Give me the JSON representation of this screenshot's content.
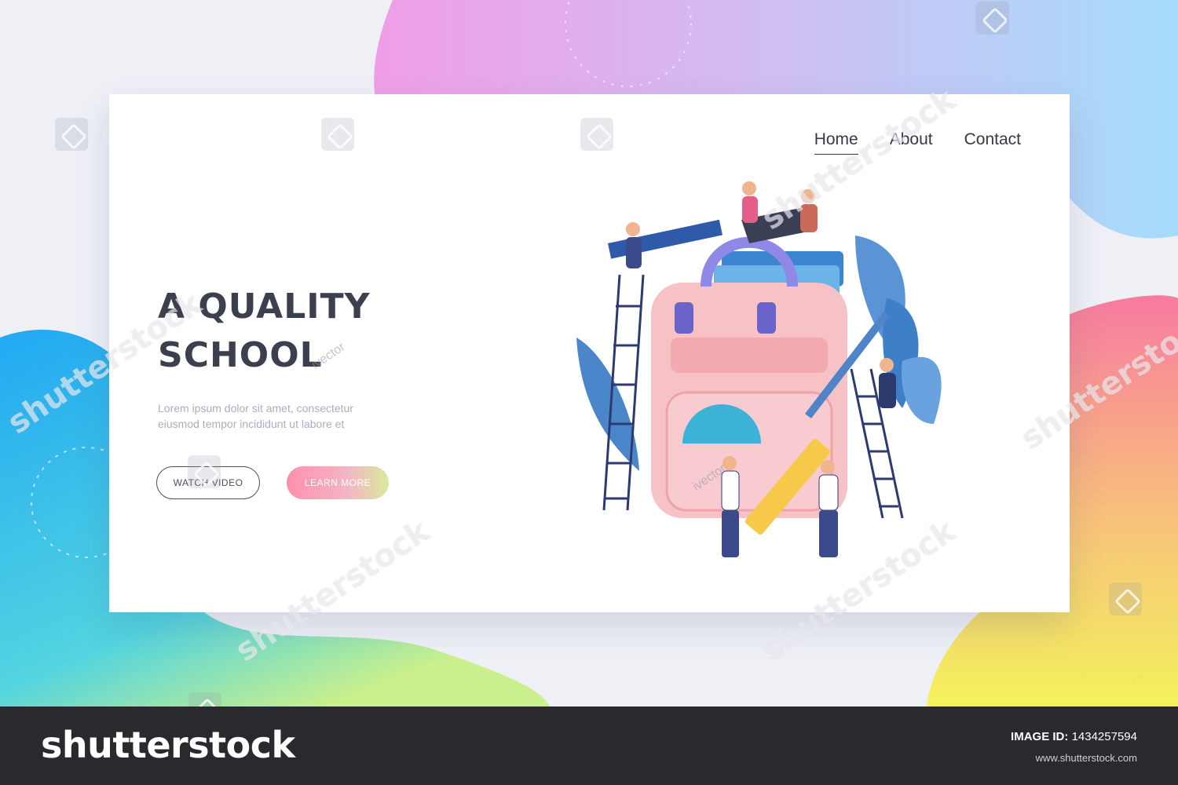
{
  "nav": {
    "items": [
      {
        "label": "Home",
        "active": true
      },
      {
        "label": "About",
        "active": false
      },
      {
        "label": "Contact",
        "active": false
      }
    ]
  },
  "hero": {
    "headline": "A QUALITY SCHOOL",
    "lead": "Lorem ipsum dolor sit amet, consectetur eiusmod tempor incididunt ut labore et",
    "watch_button": "WATCH VIDEO",
    "learn_button": "LEARN MORE"
  },
  "watermark": {
    "text": "shutterstock",
    "vector_tag": "ivector"
  },
  "footer": {
    "brand": "shutterstock",
    "image_id_label": "IMAGE ID:",
    "image_id_value": "1434257594",
    "site": "www.shutterstock.com"
  },
  "colors": {
    "accent_pink": "#ff8fab",
    "accent_green": "#d9ea9c",
    "blob_blue": "#28b3f0",
    "blob_violet": "#e9a6f0",
    "blob_yellow": "#f2f35a",
    "headline": "#3c3f4e"
  }
}
